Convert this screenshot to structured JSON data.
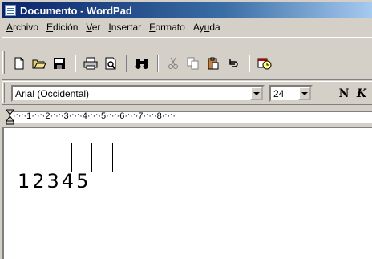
{
  "window": {
    "title": "Documento - WordPad"
  },
  "menu": [
    {
      "first": "A",
      "rest": "rchivo"
    },
    {
      "first": "E",
      "rest": "dición"
    },
    {
      "first": "V",
      "rest": "er"
    },
    {
      "first": "I",
      "rest": "nsertar",
      "pre": ""
    },
    {
      "first": "F",
      "rest": "ormato"
    },
    {
      "pre": "Ay",
      "first": "u",
      "rest": "da"
    }
  ],
  "toolbar": {
    "icons": [
      "new-document-icon",
      "open-folder-icon",
      "save-disk-icon",
      "print-icon",
      "print-preview-icon",
      "find-binoculars-icon",
      "cut-scissors-icon",
      "copy-icon",
      "paste-clipboard-icon",
      "undo-icon",
      "insert-datetime-icon"
    ]
  },
  "format_bar": {
    "font_value": "Arial (Occidental)",
    "size_value": "24",
    "bold_label": "N",
    "italic_label": "K"
  },
  "ruler": {
    "text": "·ˑ·ˑ·1·ˑ·ˑ·2·ˑ·ˑ·3·ˑ·ˑ·4·ˑ·ˑ·5·ˑ·ˑ·6·ˑ·ˑ·7·ˑ·ˑ·8·ˑ·ˑ·"
  },
  "document": {
    "content": "12345"
  }
}
